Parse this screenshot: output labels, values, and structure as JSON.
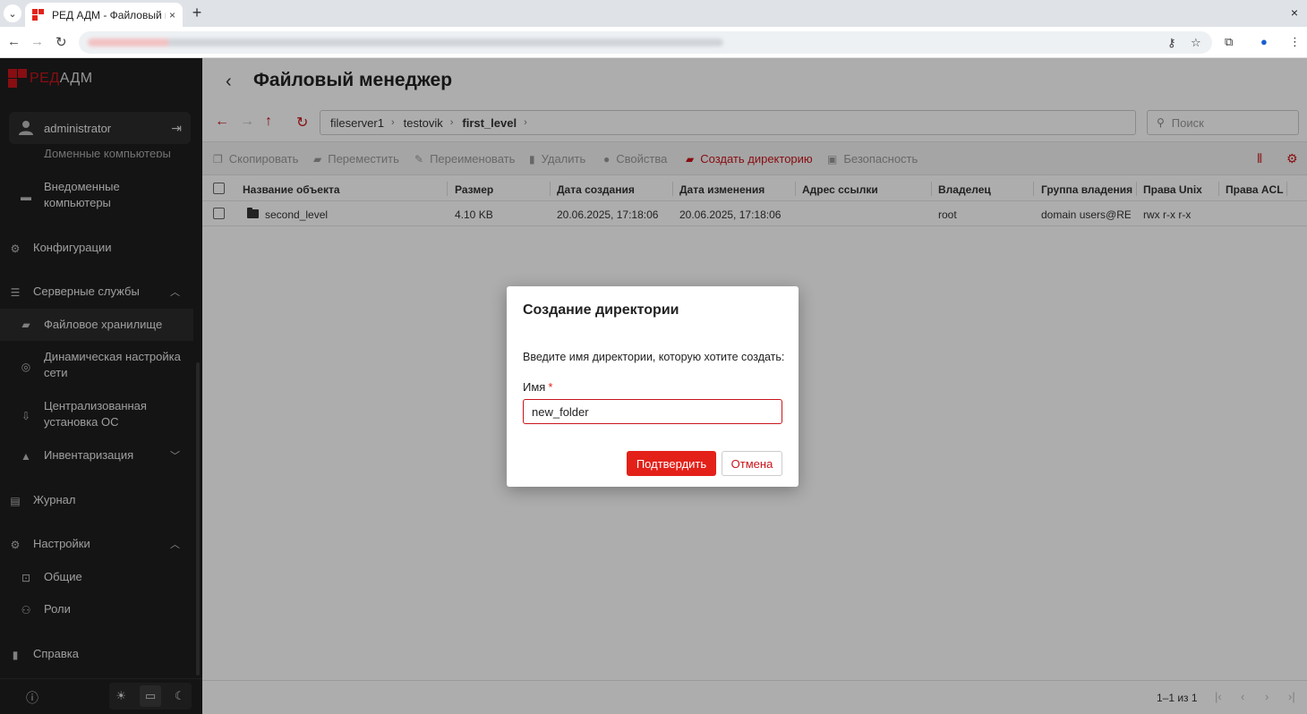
{
  "browser": {
    "tab_title": "РЕД АДМ - Файловый м",
    "tab_close": "×",
    "new_tab": "+",
    "window_close": "×"
  },
  "app": {
    "logo_red": "РЕД",
    "logo_white": "АДМ",
    "username": "administrator"
  },
  "sidebar": {
    "partial_item": "Доменные компьютеры",
    "items": [
      {
        "label": "Внедоменные компьютеры"
      },
      {
        "label": "Конфигурации"
      },
      {
        "label": "Серверные службы"
      },
      {
        "label": "Файловое хранилище"
      },
      {
        "label": "Динамическая настройка сети"
      },
      {
        "label": "Централизованная установка ОС"
      },
      {
        "label": "Инвентаризация"
      },
      {
        "label": "Журнал"
      },
      {
        "label": "Настройки"
      },
      {
        "label": "Общие"
      },
      {
        "label": "Роли"
      },
      {
        "label": "Справка"
      }
    ]
  },
  "page": {
    "title": "Файловый менеджер"
  },
  "breadcrumb": [
    "fileserver1",
    "testovik",
    "first_level"
  ],
  "search": {
    "placeholder": "Поиск"
  },
  "actions": {
    "copy": "Скопировать",
    "move": "Переместить",
    "rename": "Переименовать",
    "delete": "Удалить",
    "properties": "Свойства",
    "create_dir": "Создать директорию",
    "security": "Безопасность"
  },
  "table": {
    "headers": [
      "Название объекта",
      "Размер",
      "Дата создания",
      "Дата изменения",
      "Адрес ссылки",
      "Владелец",
      "Группа владения",
      "Права Unix",
      "Права ACL"
    ],
    "rows": [
      [
        "second_level",
        "4.10 KB",
        "20.06.2025, 17:18:06",
        "20.06.2025, 17:18:06",
        "",
        "root",
        "domain users@RE...",
        "rwx r-x r-x",
        ""
      ]
    ]
  },
  "pager": {
    "text": "1–1 из 1"
  },
  "dialog": {
    "title": "Создание директории",
    "text": "Введите имя директории, которую хотите создать:",
    "label": "Имя",
    "required_mark": "*",
    "input_value": "new_folder",
    "confirm": "Подтвердить",
    "cancel": "Отмена"
  },
  "colors": {
    "accent": "#e32119",
    "sidebar_bg": "#1e1e1e"
  }
}
